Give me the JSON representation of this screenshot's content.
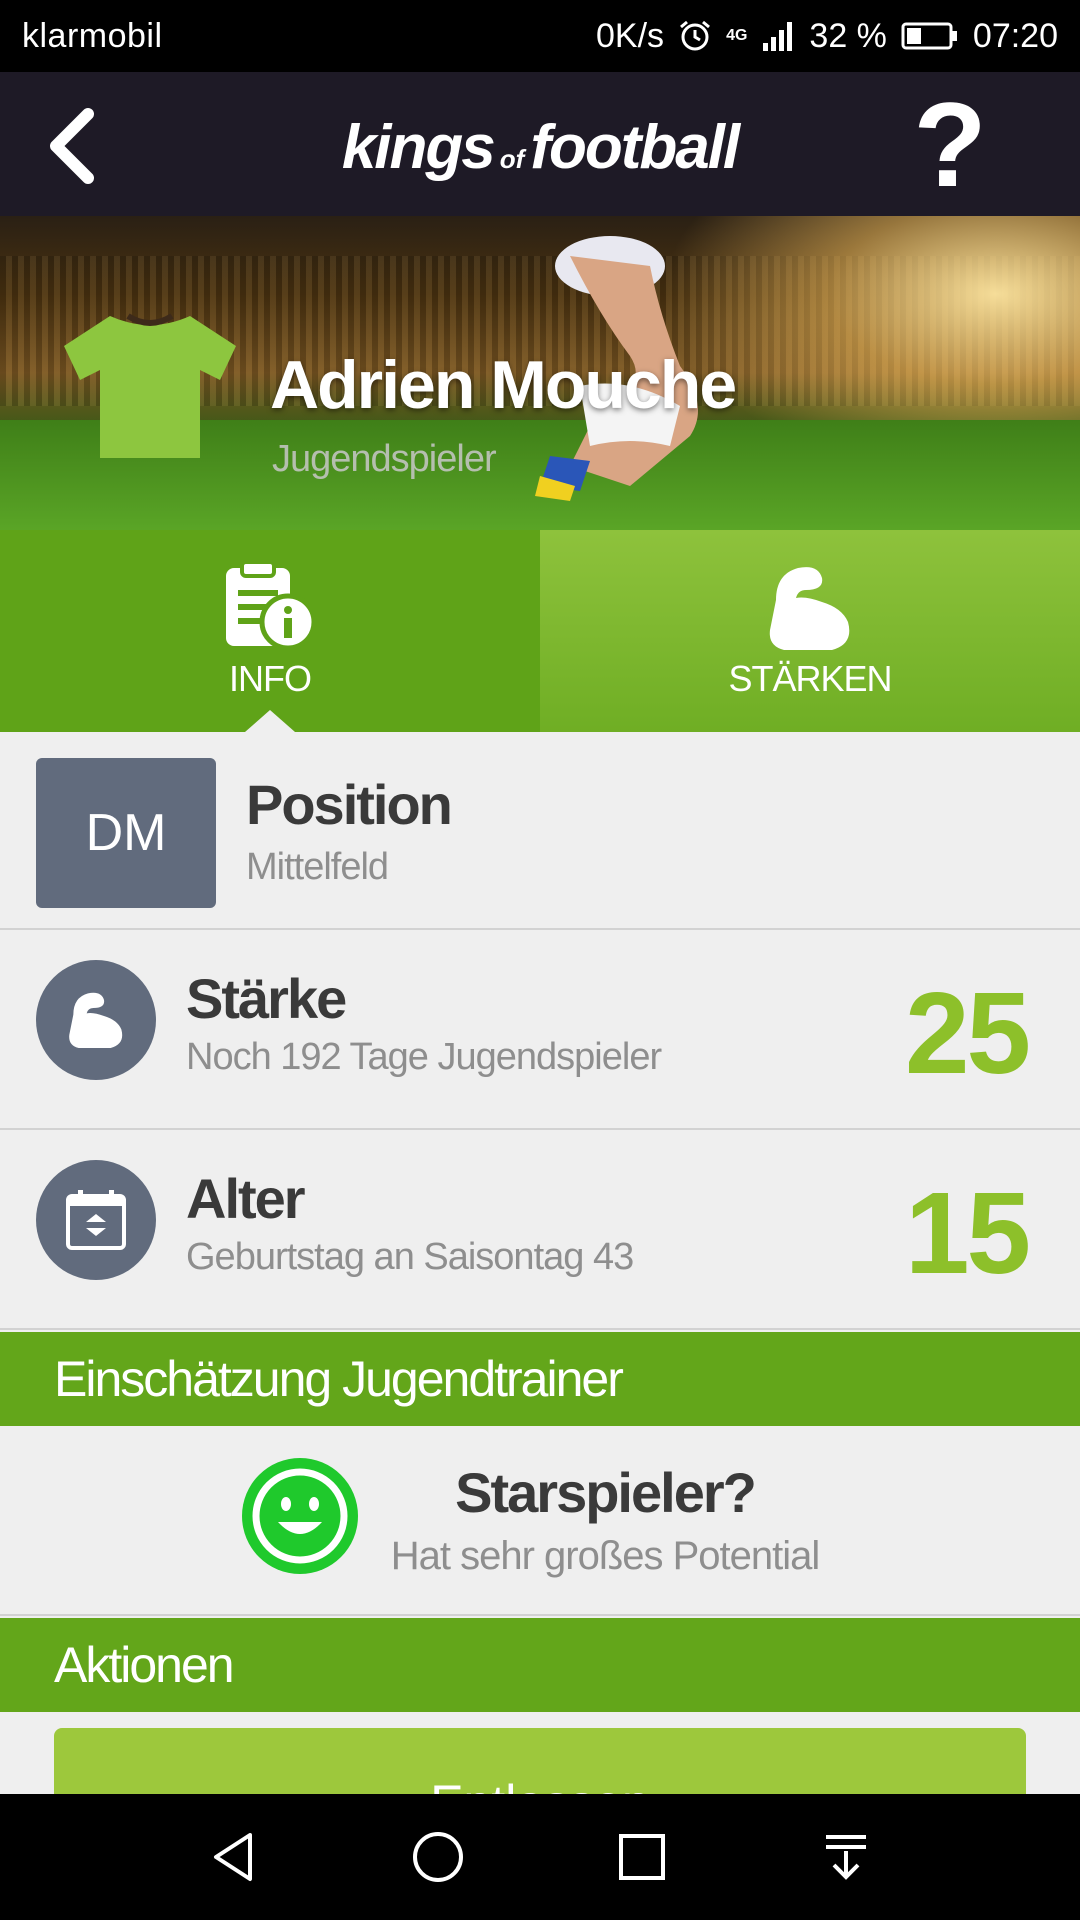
{
  "status_bar": {
    "carrier": "klarmobil",
    "speed": "0K/s",
    "network": "4G",
    "battery": "32 %",
    "time": "07:20"
  },
  "app_bar": {
    "logo_part1": "kings",
    "logo_part2": "of",
    "logo_part3": "football",
    "help_label": "?"
  },
  "player": {
    "name": "Adrien Mouche",
    "role": "Jugendspieler",
    "shirt_color": "#8dc63f"
  },
  "tabs": [
    {
      "label": "INFO",
      "icon": "clipboard-info-icon",
      "active": true
    },
    {
      "label": "STÄRKEN",
      "icon": "flexed-arm-icon",
      "active": false
    }
  ],
  "position": {
    "badge": "DM",
    "title": "Position",
    "value": "Mittelfeld"
  },
  "strength": {
    "title": "Stärke",
    "subtitle": "Noch 192 Tage Jugendspieler",
    "value": "25"
  },
  "age": {
    "title": "Alter",
    "subtitle": "Geburtstag an Saisontag 43",
    "value": "15"
  },
  "assessment_section": {
    "title": "Einschätzung Jugendtrainer"
  },
  "assessment": {
    "title": "Starspieler?",
    "subtitle": "Hat sehr großes Potential",
    "icon": "smiley-icon"
  },
  "actions_section": {
    "title": "Aktionen"
  },
  "actions": {
    "release_label": "Entlassen"
  },
  "colors": {
    "accent_green": "#63a61a",
    "value_green": "#8dc02a",
    "header_bg": "#1e1a26",
    "badge_gray": "#616b7d"
  }
}
